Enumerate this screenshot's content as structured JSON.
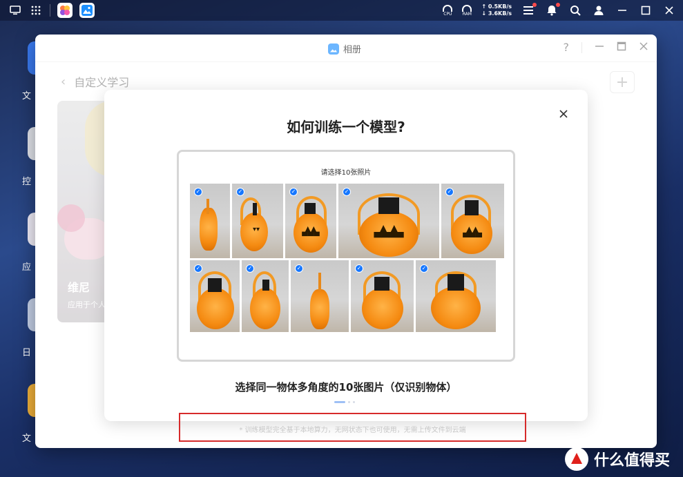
{
  "colors": {
    "accent": "#1677ff",
    "highlight_box": "#d62a2a",
    "pumpkin_orange": "#f58b12"
  },
  "topbar": {
    "cpu_label": "CPU",
    "ram_label": "RAM",
    "upload_speed": "↑ 0.5KB/s",
    "download_speed": "↓ 3.6KB/s",
    "icons": [
      "monitor-icon",
      "grid-icon",
      "photos-app-icon",
      "gallery-app-icon",
      "settings-sliders-icon",
      "bell-icon",
      "search-icon",
      "user-icon",
      "minimize-icon",
      "maximize-icon",
      "close-icon"
    ]
  },
  "desktop": {
    "labels": [
      "文",
      "控",
      "应",
      "日",
      "文"
    ]
  },
  "window": {
    "title": "相册",
    "help": "?",
    "breadcrumb": "自定义学习",
    "add_button": "+",
    "card": {
      "name": "维尼",
      "desc": "应用于个人"
    }
  },
  "modal": {
    "title": "如何训练一个模型?",
    "frame_caption": "请选择10张照片",
    "subtitle": "选择同一物体多角度的10张图片（仅识别物体）",
    "close_icon": "close-icon",
    "selected_count": 10
  },
  "footnote": "* 训练模型完全基于本地算力，无网状态下也可使用，无需上传文件到云端",
  "watermark": "什么值得买"
}
